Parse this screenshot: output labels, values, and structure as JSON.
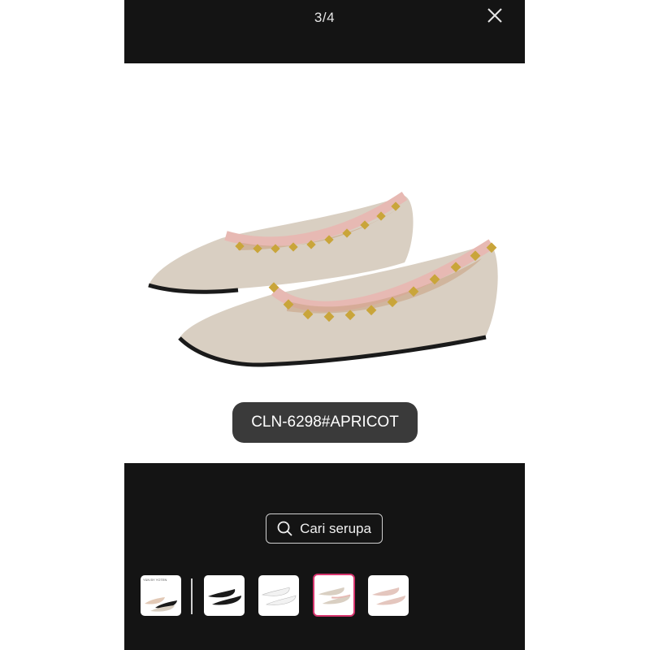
{
  "header": {
    "counter": "3/4",
    "close_icon": "close-icon"
  },
  "product": {
    "label": "CLN-6298#APRICOT",
    "colors": {
      "upper": "#d9cfc2",
      "trim": "#e7b9b3",
      "studs": "#c9a53a",
      "sole": "#1a1a1a"
    }
  },
  "actions": {
    "search_label": "Cari serupa",
    "search_icon": "search-icon"
  },
  "thumbnails": [
    {
      "name": "thumbnail-1",
      "caption": "Y&N BY YOTEN",
      "active": false
    },
    {
      "name": "thumbnail-2",
      "active": false
    },
    {
      "name": "thumbnail-3",
      "active": false
    },
    {
      "name": "thumbnail-4",
      "active": true
    },
    {
      "name": "thumbnail-5",
      "active": false
    }
  ],
  "theme": {
    "accent": "#d6356e",
    "background": "#141414"
  }
}
